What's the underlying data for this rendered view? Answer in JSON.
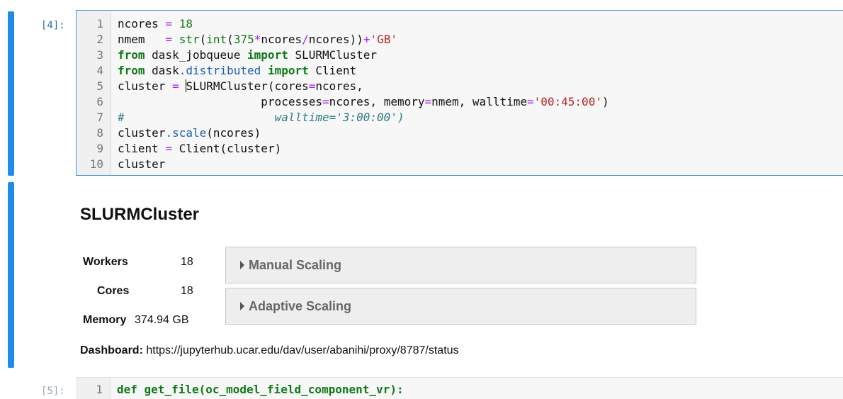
{
  "cell1": {
    "prompt": "[4]:",
    "line_numbers": [
      "1",
      "2",
      "3",
      "4",
      "5",
      "6",
      "7",
      "8",
      "9",
      "10"
    ]
  },
  "output": {
    "title": "SLURMCluster",
    "workers_label": "Workers",
    "workers_value": "18",
    "cores_label": "Cores",
    "cores_value": "18",
    "memory_label": "Memory",
    "memory_value": "374.94 GB",
    "manual_scaling": "Manual Scaling",
    "adaptive_scaling": "Adaptive Scaling",
    "dashboard_label": "Dashboard:",
    "dashboard_url": "https://jupyterhub.ucar.edu/dav/user/abanihi/proxy/8787/status"
  },
  "cell3": {
    "prompt": "[5]:",
    "line_number": "1",
    "code_line": "def get_file(oc_model_field_component_vr):"
  },
  "colors": {
    "cell_bar": "#1f8ce8",
    "keyword": "#0b7a16",
    "operator": "#aa22ff",
    "string": "#ba2121",
    "comment": "#2e7d84"
  }
}
